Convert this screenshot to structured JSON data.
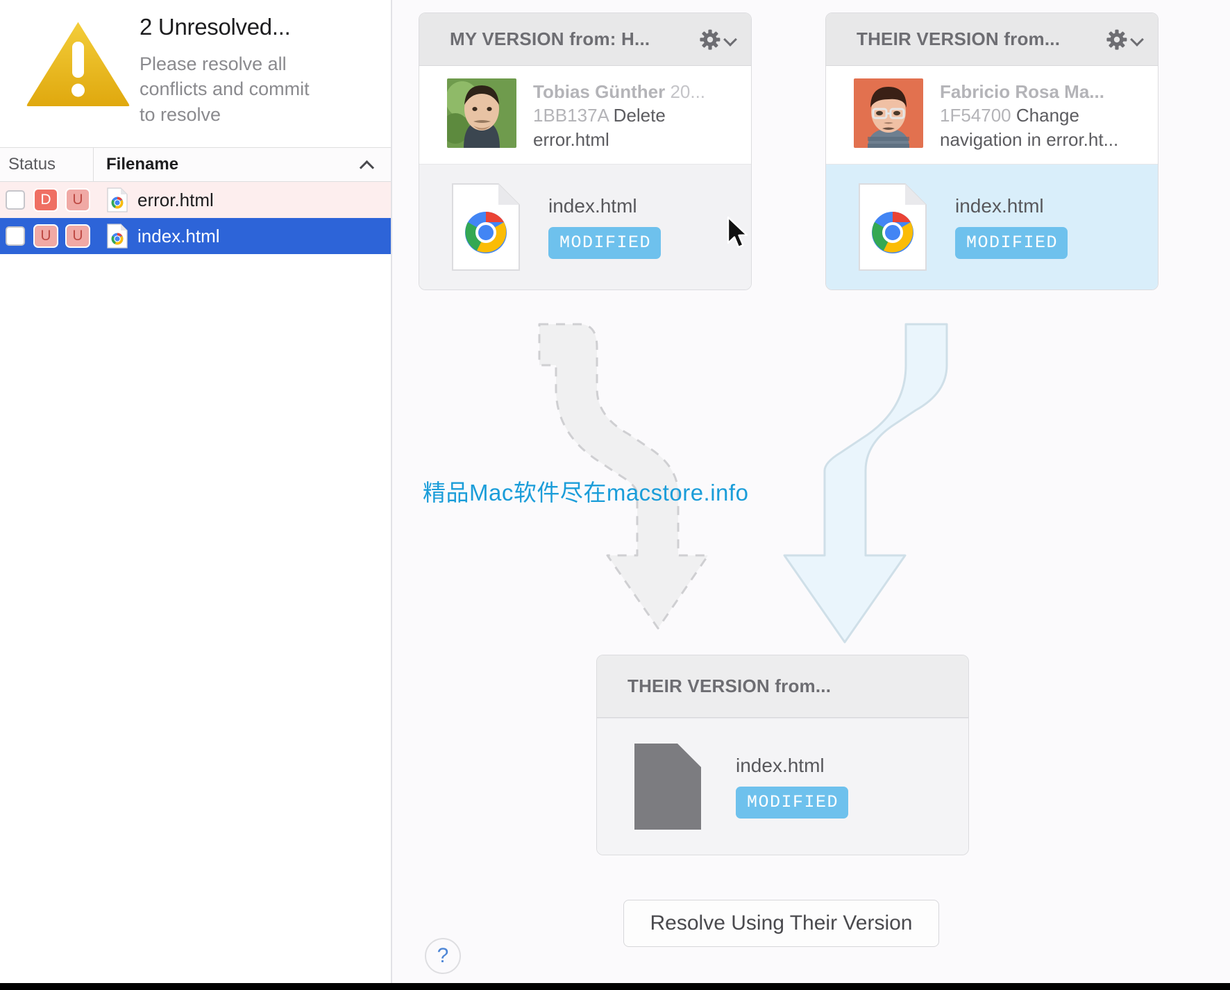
{
  "sidebar": {
    "warning": {
      "icon": "warning-triangle-icon",
      "title": "2 Unresolved...",
      "subtitle": "Please resolve all conflicts and commit to resolve"
    },
    "columns": {
      "status": "Status",
      "filename": "Filename",
      "sort_direction_icon": "chevron-up-icon"
    },
    "rows": [
      {
        "checked": false,
        "badges": [
          "D",
          "U"
        ],
        "file_icon": "chrome-html-file-icon",
        "filename": "error.html",
        "state": "conflict"
      },
      {
        "checked": false,
        "badges": [
          "U",
          "U"
        ],
        "file_icon": "chrome-html-file-icon",
        "filename": "index.html",
        "state": "selected"
      }
    ]
  },
  "main": {
    "my_version": {
      "title": "MY VERSION from: H...",
      "gear_icon": "gear-icon",
      "chevron_icon": "chevron-down-icon",
      "commit": {
        "author": "Tobias Günther",
        "date": "20...",
        "hash": "1BB137A",
        "message": "Delete error.html"
      },
      "file": {
        "icon": "chrome-html-file-icon",
        "name": "index.html",
        "status_badge": "MODIFIED"
      }
    },
    "their_version": {
      "title": "THEIR VERSION from...",
      "gear_icon": "gear-icon",
      "chevron_icon": "chevron-down-icon",
      "commit": {
        "author": "Fabricio Rosa Ma...",
        "date": "",
        "hash": "1F54700",
        "message": "Change navigation in error.ht..."
      },
      "file": {
        "icon": "chrome-html-file-icon",
        "name": "index.html",
        "status_badge": "MODIFIED"
      }
    },
    "result": {
      "title": "THEIR VERSION from...",
      "file": {
        "icon": "generic-file-icon",
        "name": "index.html",
        "status_badge": "MODIFIED"
      }
    },
    "resolve_button": "Resolve Using Their Version",
    "help_button": "?",
    "watermark": "精品Mac软件尽在macstore.info",
    "arrows": {
      "left": "dashed-arrow-inactive",
      "right": "solid-arrow-active"
    },
    "cursor": "mouse-pointer"
  },
  "colors": {
    "selection_blue": "#2d64d8",
    "conflict_row": "#fdeeee",
    "badge_delete": "#ef6f63",
    "badge_unmerged": "#f0a9a5",
    "modified_badge": "#6ec1ed",
    "selected_card_tint": "#d9eefa",
    "warning_yellow": "#e8b619",
    "watermark": "#1b9dd9",
    "help_blue": "#4e86d6"
  }
}
